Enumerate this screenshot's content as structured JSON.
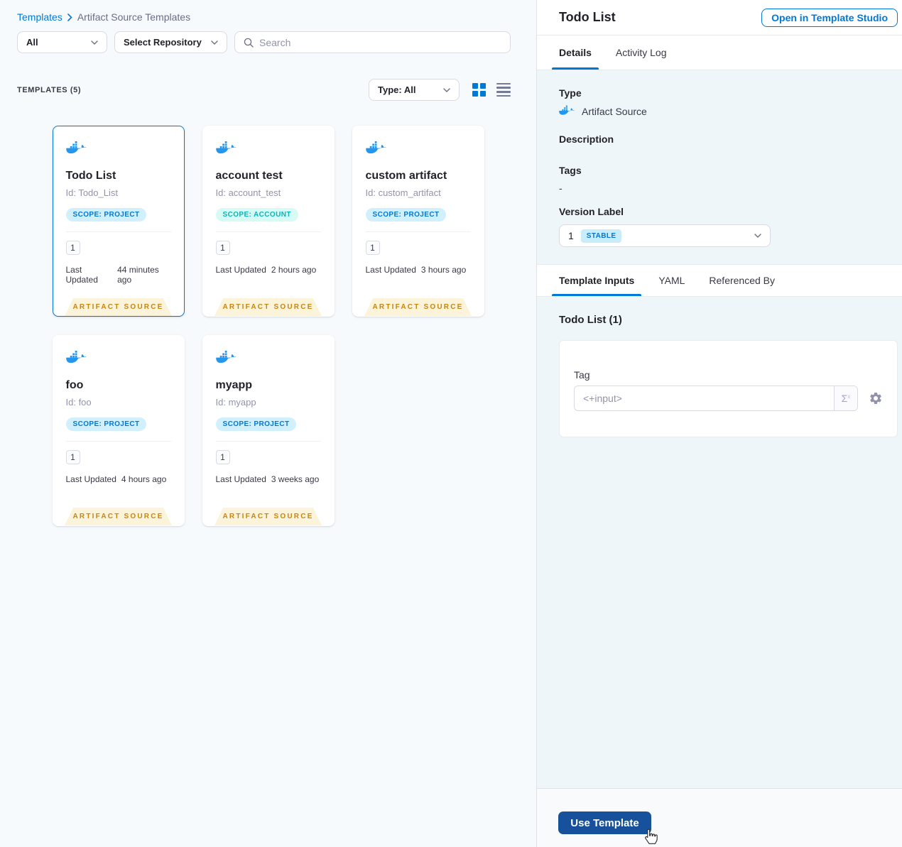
{
  "breadcrumb": {
    "templates_link": "Templates",
    "current": "Artifact Source Templates"
  },
  "filters": {
    "scope_value": "All",
    "repository_value": "Select Repository",
    "search_placeholder": "Search"
  },
  "list_header": {
    "count": "TEMPLATES (5)",
    "type_filter": "Type: All"
  },
  "cards": [
    {
      "name": "Todo List",
      "id": "Id: Todo_List",
      "scope": "SCOPE: PROJECT",
      "scope_type": "project",
      "version": "1",
      "updated_label": "Last Updated",
      "updated_value": "44 minutes ago",
      "type_tag": "ARTIFACT SOURCE",
      "selected": true
    },
    {
      "name": "account test",
      "id": "Id: account_test",
      "scope": "SCOPE: ACCOUNT",
      "scope_type": "account",
      "version": "1",
      "updated_label": "Last Updated",
      "updated_value": "2 hours ago",
      "type_tag": "ARTIFACT SOURCE",
      "selected": false
    },
    {
      "name": "custom artifact",
      "id": "Id: custom_artifact",
      "scope": "SCOPE: PROJECT",
      "scope_type": "project",
      "version": "1",
      "updated_label": "Last Updated",
      "updated_value": "3 hours ago",
      "type_tag": "ARTIFACT SOURCE",
      "selected": false
    },
    {
      "name": "foo",
      "id": "Id: foo",
      "scope": "SCOPE: PROJECT",
      "scope_type": "project",
      "version": "1",
      "updated_label": "Last Updated",
      "updated_value": "4 hours ago",
      "type_tag": "ARTIFACT SOURCE",
      "selected": false
    },
    {
      "name": "myapp",
      "id": "Id: myapp",
      "scope": "SCOPE: PROJECT",
      "scope_type": "project",
      "version": "1",
      "updated_label": "Last Updated",
      "updated_value": "3 weeks ago",
      "type_tag": "ARTIFACT SOURCE",
      "selected": false
    }
  ],
  "panel": {
    "title": "Todo List",
    "open_button": "Open in Template Studio",
    "tabs": {
      "details": "Details",
      "activity_log": "Activity Log"
    },
    "details": {
      "type_label": "Type",
      "type_value": "Artifact Source",
      "description_label": "Description",
      "tags_label": "Tags",
      "tags_value": "-",
      "version_label": "Version Label",
      "version_value": "1",
      "version_badge": "STABLE"
    },
    "inputs_tabs": {
      "template_inputs": "Template Inputs",
      "yaml": "YAML",
      "referenced_by": "Referenced By"
    },
    "inputs": {
      "heading": "Todo List (1)",
      "tag_label": "Tag",
      "tag_value": "<+input>",
      "expression_symbol": "Σ",
      "expression_sup": "x"
    },
    "footer": {
      "use_button": "Use Template"
    }
  },
  "icons": {
    "docker": "docker-whale-icon",
    "search": "search-icon",
    "grid": "grid-view-icon",
    "list": "list-view-icon",
    "chevron": "chevron-down-icon",
    "gear": "gear-icon",
    "expression": "expression-sigma-icon",
    "cursor": "hand-pointer-cursor"
  },
  "colors": {
    "accent": "#0278d5",
    "docker_blue": "#2496ed",
    "use_button": "#17519c",
    "artifact_tag_text": "#c8860e",
    "artifact_tag_bg": "#fbf3da",
    "scope_project_bg": "#d1f0fd",
    "scope_account_text": "#0ab3bd",
    "stable_bg": "#c9ecfb"
  }
}
